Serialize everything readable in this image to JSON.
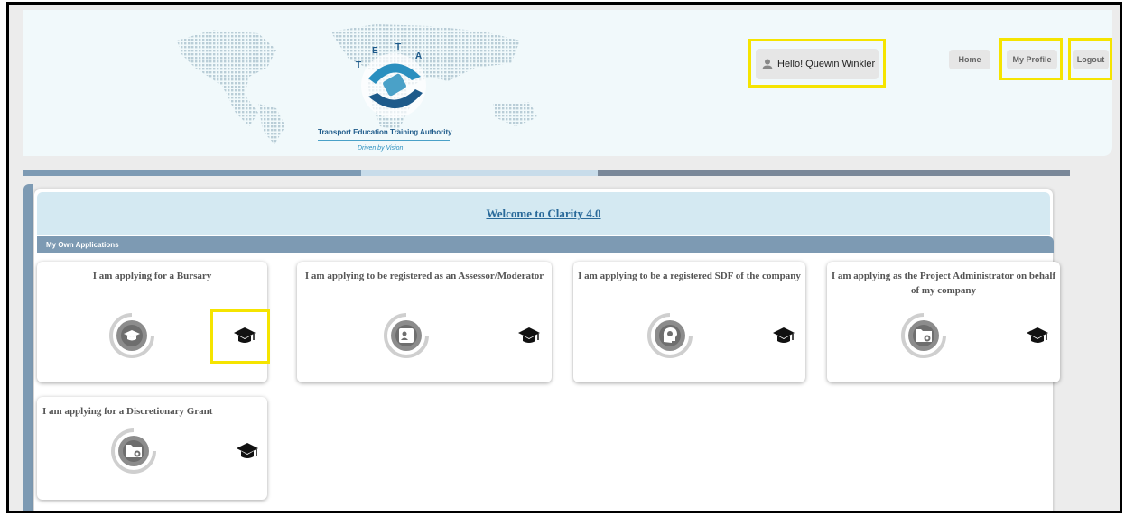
{
  "header": {
    "brand_name": "Transport Education Training Authority",
    "tagline": "Driven by Vision",
    "logo_letters": "TETA",
    "greeting": "Hello! Quewin Winkler",
    "nav": {
      "home": "Home",
      "profile": "My Profile",
      "logout": "Logout"
    }
  },
  "main": {
    "welcome": "Welcome to Clarity 4.0",
    "section_title": "My Own Applications",
    "cards": [
      {
        "title": "I am applying for a Bursary",
        "icon": "graduation-cap-icon"
      },
      {
        "title": "I am applying to be registered as an Assessor/Moderator",
        "icon": "id-card-icon"
      },
      {
        "title": "I am applying to be a registered SDF of the company",
        "icon": "head-gear-icon"
      },
      {
        "title": "I am applying as the Project Administrator on behalf of my company",
        "icon": "folder-settings-icon"
      },
      {
        "title": "I am applying for a Discretionary Grant",
        "icon": "folder-settings-icon"
      }
    ]
  },
  "colors": {
    "header_bg": "#f1f9fb",
    "section_bar": "#7d9ab3",
    "welcome_bg": "#d4e9f2",
    "highlight": "#f5e400",
    "link": "#2a6a9a"
  }
}
